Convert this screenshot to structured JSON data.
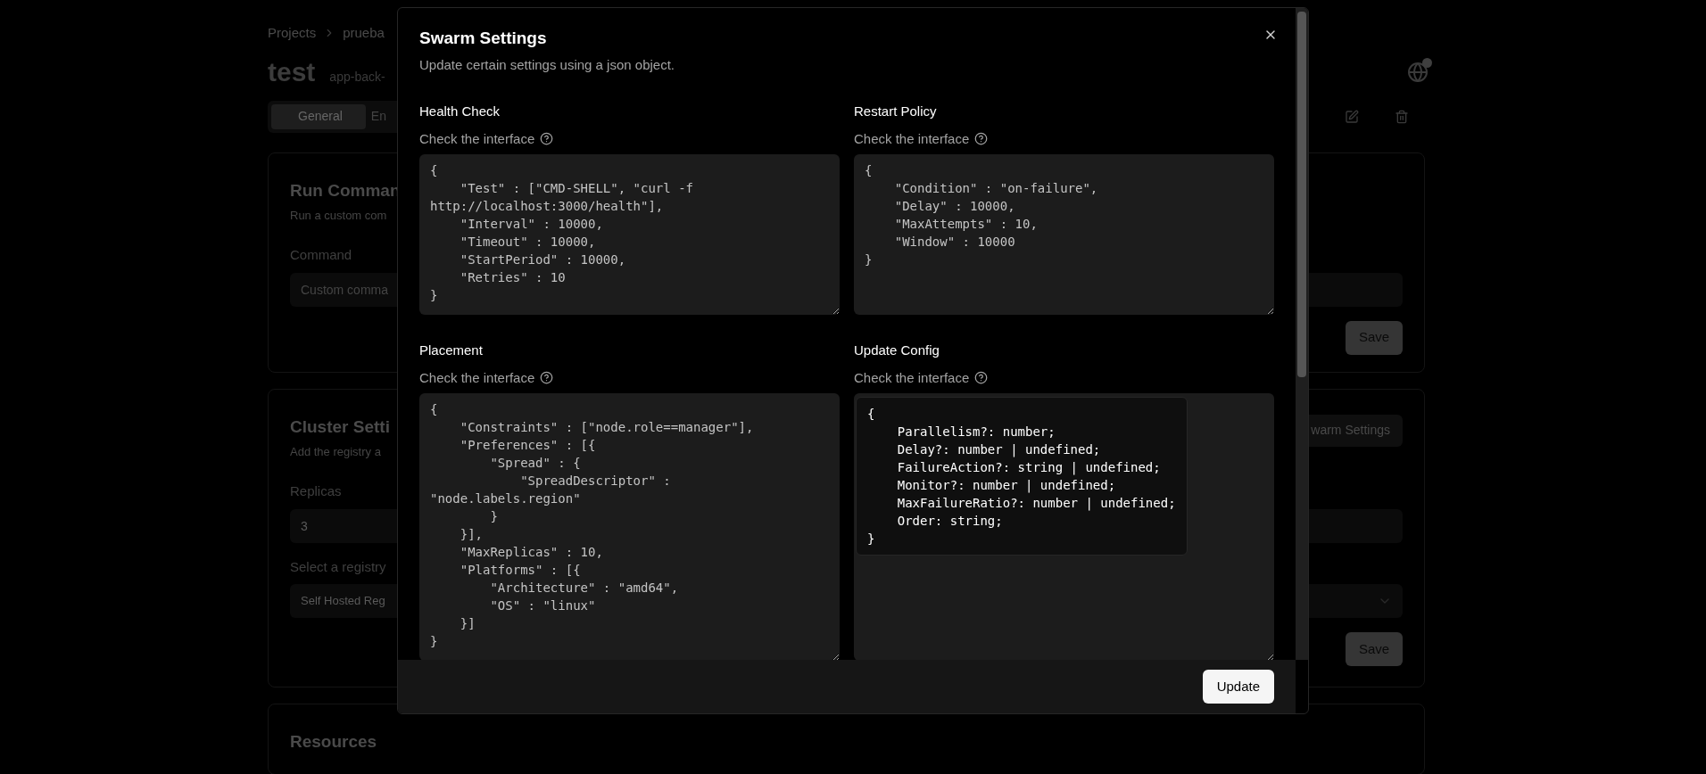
{
  "breadcrumb": [
    {
      "label": "Projects"
    },
    {
      "label": "prueba"
    }
  ],
  "page": {
    "title": "test",
    "app_name": "app-back-"
  },
  "tabs": [
    {
      "label": "General",
      "selected": true
    },
    {
      "label": "En",
      "selected": false
    }
  ],
  "cards": [
    {
      "kind": "command",
      "title": "Run Comman",
      "description": "Run a custom com",
      "fields": [
        {
          "kind": "input",
          "label": "Command",
          "placeholder": "Custom comma"
        }
      ],
      "save": "Save"
    },
    {
      "kind": "cluster",
      "title": "Cluster Setti",
      "description": "Add the registry a",
      "header_button": "warm Settings",
      "fields": [
        {
          "kind": "input",
          "label": "Replicas",
          "value": "3"
        },
        {
          "kind": "select",
          "label": "Select a registry",
          "value": "Self Hosted Reg"
        }
      ],
      "save": "Save"
    },
    {
      "kind": "resources",
      "title": "Resources"
    }
  ],
  "dialog": {
    "title": "Swarm Settings",
    "description": "Update certain settings using a json object.",
    "sections": [
      {
        "label": "Health Check",
        "hint": "Check the interface",
        "value": "{\n    \"Test\" : [\"CMD-SHELL\", \"curl -f http://localhost:3000/health\"],\n    \"Interval\" : 10000,\n    \"Timeout\" : 10000,\n    \"StartPeriod\" : 10000,\n    \"Retries\" : 10\n}"
      },
      {
        "label": "Restart Policy",
        "hint": "Check the interface",
        "value": "{\n    \"Condition\" : \"on-failure\",\n    \"Delay\" : 10000,\n    \"MaxAttempts\" : 10,\n    \"Window\" : 10000\n}"
      },
      {
        "label": "Placement",
        "hint": "Check the interface",
        "value": "{\n    \"Constraints\" : [\"node.role==manager\"],\n    \"Preferences\" : [{\n        \"Spread\" : {\n            \"SpreadDescriptor\" : \"node.labels.region\"\n        }\n    }],\n    \"MaxReplicas\" : 10,\n    \"Platforms\" : [{\n        \"Architecture\" : \"amd64\",\n        \"OS\" : \"linux\"\n    }]\n}"
      },
      {
        "label": "Update Config",
        "hint": "Check the interface",
        "tooltip": "{\n    Parallelism?: number;\n    Delay?: number | undefined;\n    FailureAction?: string | undefined;\n    Monitor?: number | undefined;\n    MaxFailureRatio?: number | undefined;\n    Order: string;\n}"
      }
    ],
    "submit": "Update"
  }
}
